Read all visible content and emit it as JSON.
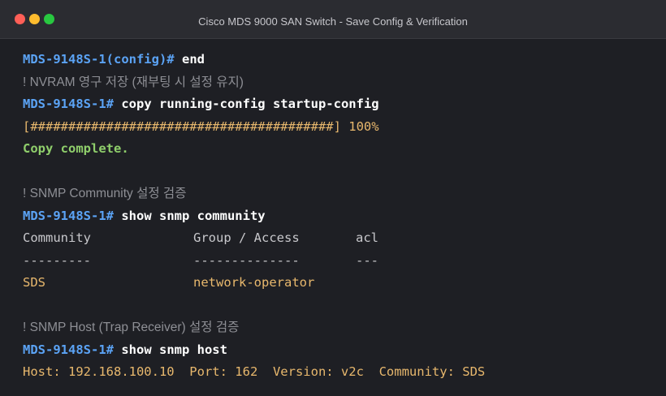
{
  "window": {
    "title": "Cisco MDS 9000 SAN Switch - Save Config & Verification"
  },
  "terminal": {
    "line1": {
      "prompt": "MDS-9148S-1(config)#",
      "command": "end"
    },
    "comment1": "! NVRAM 영구 저장 (재부팅 시 설정 유지)",
    "line2": {
      "prompt": "MDS-9148S-1#",
      "command": "copy running-config startup-config"
    },
    "progress": "[########################################] 100%",
    "copy_complete": "Copy complete.",
    "comment2": "! SNMP Community 설정 검증",
    "line3": {
      "prompt": "MDS-9148S-1#",
      "command": "show snmp community"
    },
    "community_table": {
      "headers": [
        "Community",
        "Group / Access",
        "acl"
      ],
      "separators": [
        "---------",
        "--------------",
        "---"
      ],
      "row": [
        "SDS",
        "network-operator",
        ""
      ]
    },
    "comment3": "! SNMP Host (Trap Receiver) 설정 검증",
    "line4": {
      "prompt": "MDS-9148S-1#",
      "command": "show snmp host"
    },
    "host_output": "Host: 192.168.100.10  Port: 162  Version: v2c  Community: SDS"
  },
  "colors": {
    "prompt": "#5ba3f5",
    "command": "#ffffff",
    "comment": "#8e8f95",
    "value": "#e8b86d",
    "success": "#8fce6b"
  }
}
